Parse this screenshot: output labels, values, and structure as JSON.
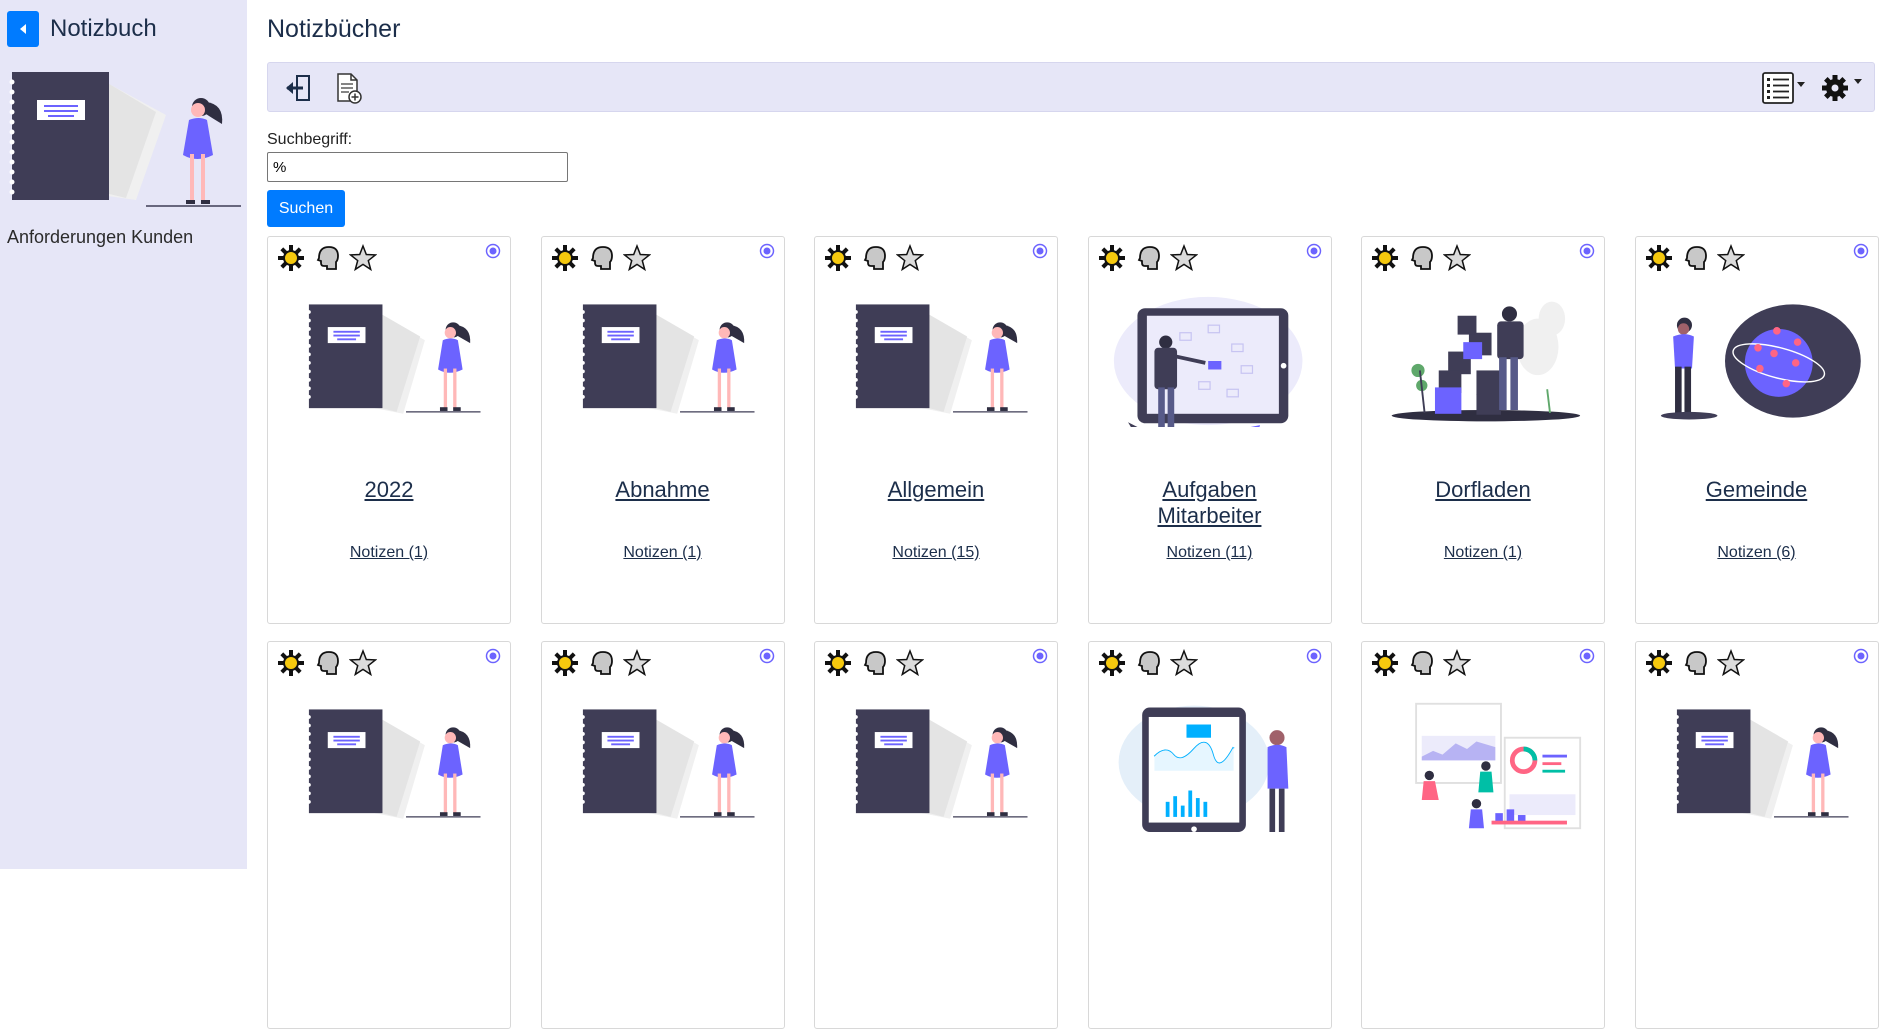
{
  "sidebar": {
    "title": "Notizbuch",
    "note": "Anforderungen Kunden"
  },
  "header": {
    "title": "Notizbücher"
  },
  "search": {
    "label": "Suchbegriff:",
    "value": "%",
    "button_label": "Suchen"
  },
  "colors": {
    "accent": "#007bff",
    "sidebar_bg": "#e6e6f7",
    "purple": "#6c63ff",
    "dark": "#3f3d56"
  },
  "notebooks": [
    {
      "title": "2022",
      "notes": "Notizen (1)",
      "image": "notebook-illustration"
    },
    {
      "title": "Abnahme",
      "notes": "Notizen (1)",
      "image": "notebook-illustration"
    },
    {
      "title": "Allgemein",
      "notes": "Notizen (15)",
      "image": "notebook-illustration"
    },
    {
      "title": "Aufgaben Mitarbeiter",
      "notes": "Notizen (11)",
      "image": "presentation-illustration"
    },
    {
      "title": "Dorfladen",
      "notes": "Notizen (1)",
      "image": "boxes-illustration"
    },
    {
      "title": "Gemeinde",
      "notes": "Notizen (6)",
      "image": "globe-illustration"
    },
    {
      "image": "notebook-illustration"
    },
    {
      "image": "notebook-illustration"
    },
    {
      "image": "notebook-illustration"
    },
    {
      "image": "tablet-chart-illustration"
    },
    {
      "image": "dashboard-illustration"
    },
    {
      "image": "notebook-illustration"
    }
  ]
}
